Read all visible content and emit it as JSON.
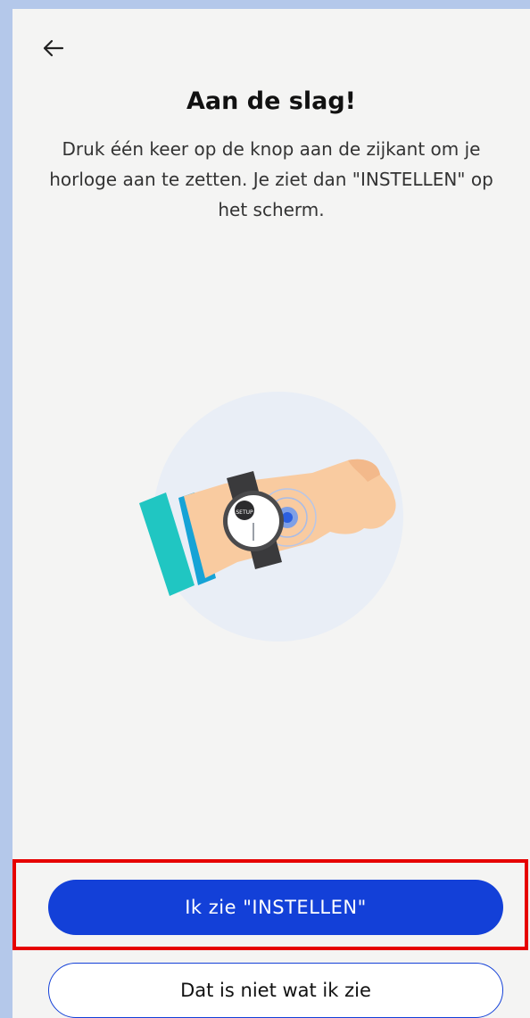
{
  "header": {
    "back_icon": "arrow-left-icon",
    "title": "Aan de slag!"
  },
  "instructions": {
    "text": "Druk één keer op de knop aan de zijkant om je horloge aan te zetten. Je ziet dan \"INSTELLEN\" op het scherm."
  },
  "illustration": {
    "watch_screen_label": "SETUP"
  },
  "actions": {
    "primary_label": "Ik zie \"INSTELLEN\"",
    "secondary_label": "Dat is niet wat ik zie"
  },
  "colors": {
    "accent": "#1340d8",
    "highlight": "#e60000",
    "background": "#f4f4f3"
  }
}
